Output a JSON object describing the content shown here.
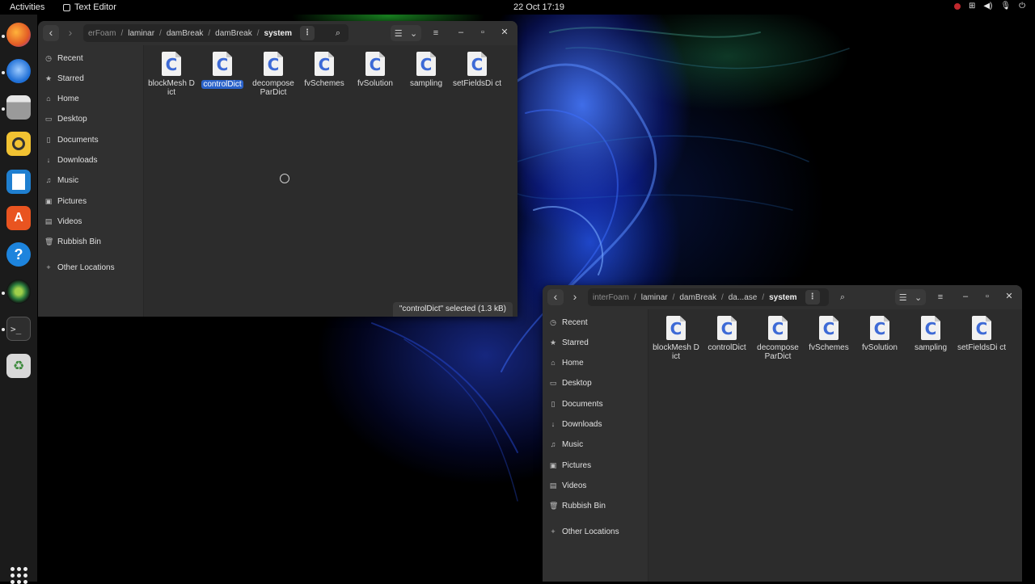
{
  "topbar": {
    "activities": "Activities",
    "app_name": "Text Editor",
    "clock": "22 Oct  17:19"
  },
  "dock": {
    "apps": [
      "firefox-icon",
      "thunderbird-icon",
      "files-icon",
      "rhythmbox-icon",
      "libreoffice-writer-icon",
      "app-center-icon",
      "help-icon",
      "camera-icon",
      "terminal-icon",
      "trash-icon"
    ]
  },
  "window1": {
    "path": [
      "erFoam",
      "laminar",
      "damBreak",
      "damBreak",
      "system"
    ],
    "sidebar": [
      "Recent",
      "Starred",
      "Home",
      "Desktop",
      "Documents",
      "Downloads",
      "Music",
      "Pictures",
      "Videos",
      "Rubbish Bin",
      "Other Locations"
    ],
    "files": [
      "blockMesh Dict",
      "controlDict",
      "decompose ParDict",
      "fvSchemes",
      "fvSolution",
      "sampling",
      "setFieldsDi ct"
    ],
    "selected": "controlDict",
    "status": "\"controlDict\" selected  (1.3 kB)"
  },
  "window2": {
    "path": [
      "interFoam",
      "laminar",
      "damBreak",
      "da...ase",
      "system"
    ],
    "sidebar": [
      "Recent",
      "Starred",
      "Home",
      "Desktop",
      "Documents",
      "Downloads",
      "Music",
      "Pictures",
      "Videos",
      "Rubbish Bin",
      "Other Locations"
    ],
    "files": [
      "blockMesh Dict",
      "controlDict",
      "decompose ParDict",
      "fvSchemes",
      "fvSolution",
      "sampling",
      "setFieldsDi ct"
    ]
  },
  "file_icon_glyph": "C",
  "colors": {
    "selection": "#2a62c9",
    "window_bg": "#2c2c2c",
    "sidebar_bg": "#303030"
  }
}
